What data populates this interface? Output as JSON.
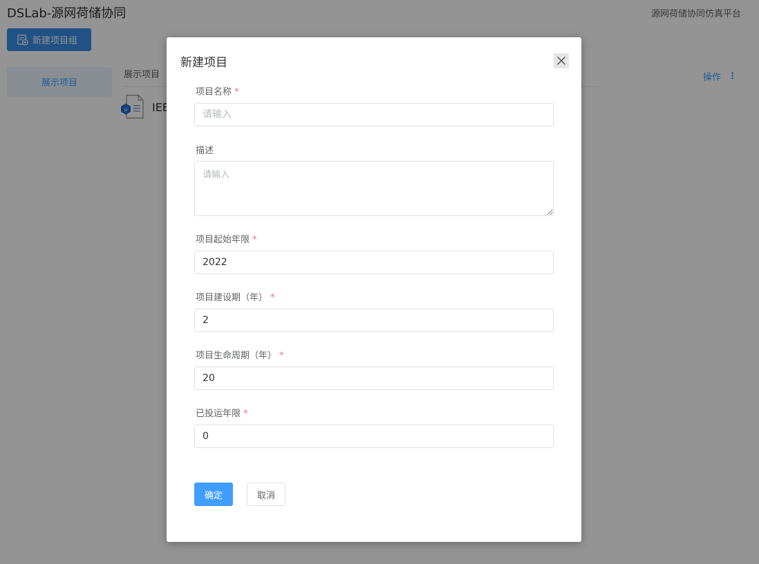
{
  "app": {
    "title": "DSLab-源网荷储协同",
    "platform_name": "源网荷储协同仿真平台"
  },
  "toolbar": {
    "new_group_label": "新建项目组",
    "new_group_icon": "folder-add-icon"
  },
  "sidebar": {
    "items": [
      {
        "label": "展示项目",
        "active": true
      }
    ]
  },
  "main": {
    "section_label": "展示项目",
    "actions_label": "操作",
    "actions_icon": "more-vertical-icon",
    "projects": [
      {
        "name": "IEE",
        "icon": "project-file-icon"
      }
    ]
  },
  "dialog": {
    "title": "新建项目",
    "close_icon": "close-icon",
    "required_mark": "*",
    "fields": {
      "name": {
        "label": "项目名称",
        "placeholder": "请输入",
        "value": "",
        "required": true
      },
      "description": {
        "label": "描述",
        "placeholder": "请输入",
        "value": "",
        "required": false
      },
      "start_year": {
        "label": "项目起始年限",
        "value": "2022",
        "required": true
      },
      "build_period": {
        "label": "项目建设期（年）",
        "value": "2",
        "required": true
      },
      "life_cycle": {
        "label": "项目生命周期（年）",
        "value": "20",
        "required": true
      },
      "operated_years": {
        "label": "已投运年限",
        "value": "0",
        "required": true
      }
    },
    "confirm_label": "确定",
    "cancel_label": "取消"
  },
  "colors": {
    "primary": "#409eff",
    "danger": "#f56c6c",
    "overlay": "rgba(0,0,0,0.42)"
  }
}
